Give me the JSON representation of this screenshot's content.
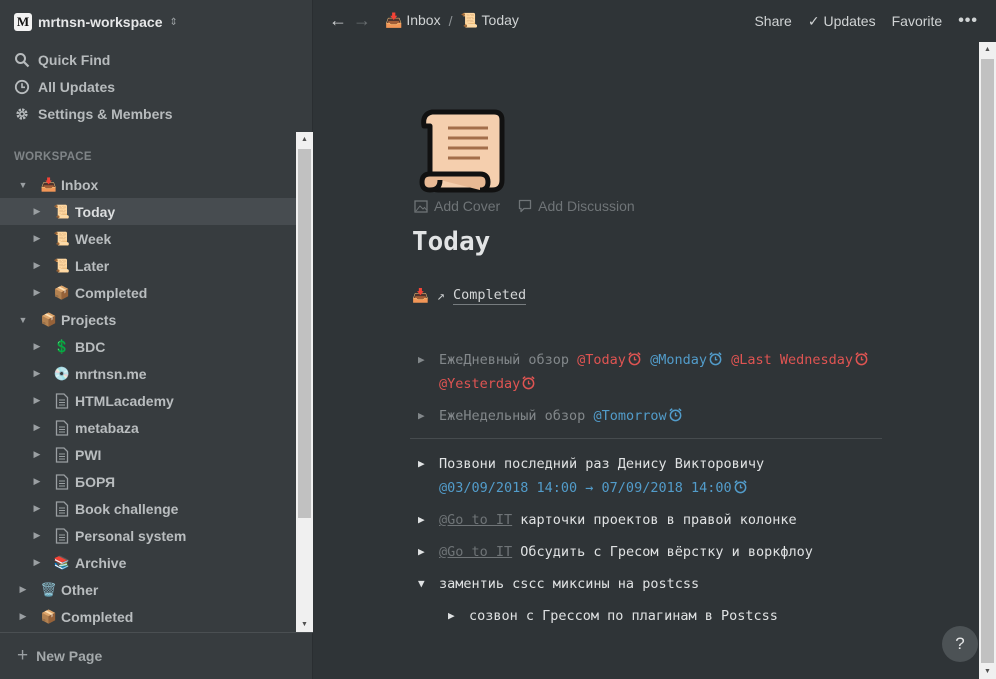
{
  "workspace": {
    "logo_letter": "M",
    "name": "mrtnsn-workspace"
  },
  "sidebar": {
    "top_items": [
      {
        "label": "Quick Find",
        "icon": "search-icon"
      },
      {
        "label": "All Updates",
        "icon": "clock-icon"
      },
      {
        "label": "Settings & Members",
        "icon": "gear-icon"
      }
    ],
    "section_label": "WORKSPACE",
    "tree": [
      {
        "label": "Inbox",
        "emoji": "📥",
        "expanded": true
      },
      {
        "label": "Today",
        "emoji": "📜",
        "active": true
      },
      {
        "label": "Week",
        "emoji": "📜"
      },
      {
        "label": "Later",
        "emoji": "📜"
      },
      {
        "label": "Completed",
        "emoji": "📦"
      },
      {
        "label": "Projects",
        "emoji": "📦",
        "expanded": true
      },
      {
        "label": "BDC",
        "emoji": "💲"
      },
      {
        "label": "mrtnsn.me",
        "emoji": "💿"
      },
      {
        "label": "HTMLacademy",
        "icon": "page-icon"
      },
      {
        "label": "metabaza",
        "icon": "page-icon"
      },
      {
        "label": "PWI",
        "icon": "page-icon"
      },
      {
        "label": "БОРЯ",
        "icon": "page-icon"
      },
      {
        "label": "Book challenge",
        "icon": "page-icon"
      },
      {
        "label": "Personal system",
        "icon": "page-icon"
      },
      {
        "label": "Archive",
        "emoji": "📚"
      },
      {
        "label": "Other",
        "emoji": "🗑️"
      },
      {
        "label": "Completed",
        "emoji": "📦"
      }
    ],
    "new_page_label": "New Page"
  },
  "topbar": {
    "breadcrumb": [
      {
        "label": "Inbox",
        "emoji": "📥"
      },
      {
        "label": "Today",
        "emoji": "📜"
      }
    ],
    "separator": "/",
    "share_label": "Share",
    "updates_label": "Updates",
    "favorite_label": "Favorite",
    "more_label": "•••"
  },
  "page": {
    "add_cover_label": "Add Cover",
    "add_discussion_label": "Add Discussion",
    "title": "Today",
    "linked_page": {
      "emoji": "📥",
      "label": "Completed"
    },
    "todos": {
      "t1": {
        "text": "ЕжеДневный обзор ",
        "m1": "@Today",
        "m2": "@Monday",
        "m3": "@Last Wednesday",
        "m4": "@Yesterday"
      },
      "t2": {
        "text": "ЕжеНедельный обзор ",
        "m1": "@Tomorrow"
      },
      "t3": {
        "text": "Позвони последний раз Денису Викторовичу",
        "m1": "@03/09/2018 14:00 → 07/09/2018 14:00"
      },
      "t4": {
        "link": "@Go to IT",
        "text": " карточки проектов в правой колонке"
      },
      "t5": {
        "link": "@Go to IT",
        "text": " Обсудить с Гресом вёрстку и воркфлоу"
      },
      "t6": {
        "text": "заментиь cscc миксины на postcss"
      },
      "t7": {
        "text": "созвон с Грессом по плагинам в Postcss"
      }
    }
  },
  "help_label": "?",
  "colors": {
    "background": "#2f3437",
    "sidebar": "#373c3f",
    "red_mention": "#df5452",
    "blue_mention": "#529cca"
  }
}
